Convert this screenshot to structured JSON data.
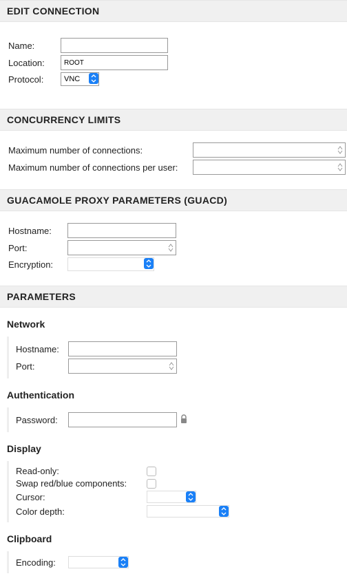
{
  "sections": {
    "edit_connection": {
      "title": "EDIT CONNECTION",
      "name_label": "Name:",
      "name_value": "",
      "location_label": "Location:",
      "location_value": "ROOT",
      "protocol_label": "Protocol:",
      "protocol_value": "VNC"
    },
    "concurrency": {
      "title": "CONCURRENCY LIMITS",
      "max_conn_label": "Maximum number of connections:",
      "max_conn_value": "",
      "max_conn_user_label": "Maximum number of connections per user:",
      "max_conn_user_value": ""
    },
    "guacd": {
      "title": "GUACAMOLE PROXY PARAMETERS (GUACD)",
      "hostname_label": "Hostname:",
      "hostname_value": "",
      "port_label": "Port:",
      "port_value": "",
      "encryption_label": "Encryption:",
      "encryption_value": ""
    },
    "params": {
      "title": "PARAMETERS",
      "network": {
        "title": "Network",
        "hostname_label": "Hostname:",
        "hostname_value": "",
        "port_label": "Port:",
        "port_value": ""
      },
      "auth": {
        "title": "Authentication",
        "password_label": "Password:",
        "password_value": ""
      },
      "display": {
        "title": "Display",
        "readonly_label": "Read-only:",
        "swap_label": "Swap red/blue components:",
        "cursor_label": "Cursor:",
        "cursor_value": "",
        "colordepth_label": "Color depth:",
        "colordepth_value": ""
      },
      "clipboard": {
        "title": "Clipboard",
        "encoding_label": "Encoding:",
        "encoding_value": ""
      }
    }
  }
}
